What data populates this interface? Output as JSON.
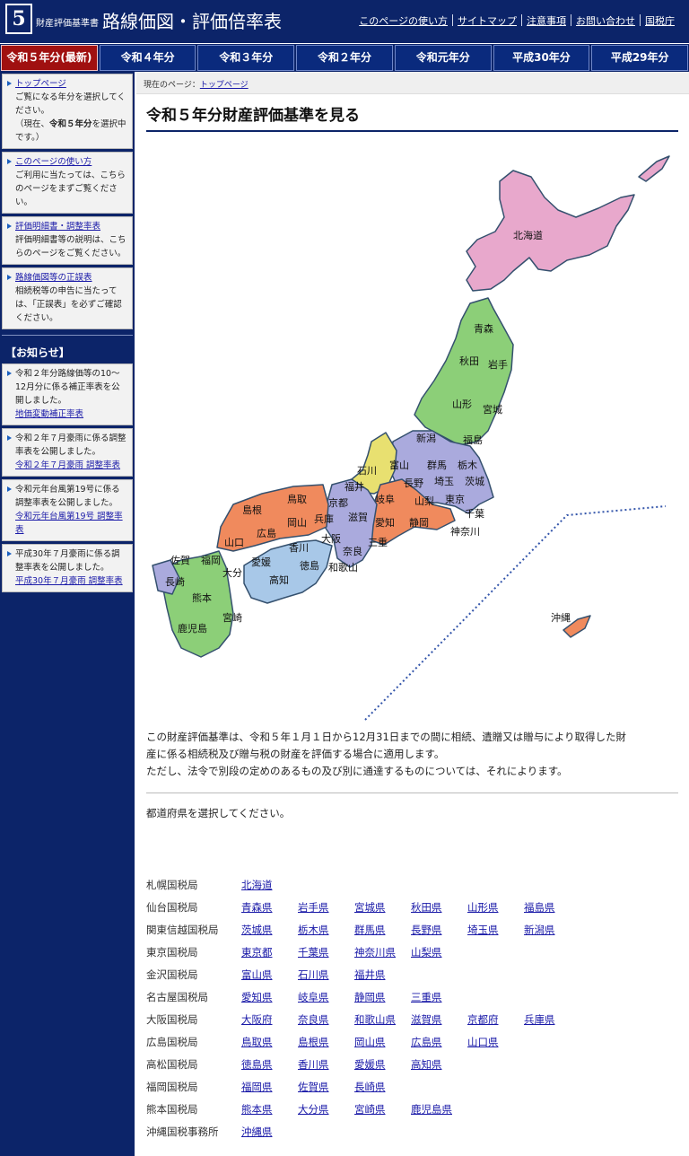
{
  "header": {
    "logo_number": "5",
    "small_title": "財産評価基準書",
    "title": "路線価図・評価倍率表",
    "nav": [
      "このページの使い方",
      "サイトマップ",
      "注意事項",
      "お問い合わせ",
      "国税庁"
    ]
  },
  "tabs": [
    "令和５年分(最新)",
    "令和４年分",
    "令和３年分",
    "令和２年分",
    "令和元年分",
    "平成30年分",
    "平成29年分"
  ],
  "sidebar": {
    "boxes": [
      {
        "title": "トップページ",
        "lines": [
          "ご覧になる年分を選択してください。",
          "（現在、",
          "令和５年分",
          "を選択中です。）"
        ]
      },
      {
        "title": "このページの使い方",
        "text": "ご利用に当たっては、こちらのページをまずご覧ください。"
      },
      {
        "title": "評価明細書・調整率表",
        "text": "評価明細書等の説明は、こちらのページをご覧ください。"
      },
      {
        "title": "路線価図等の正誤表",
        "text": "相続税等の申告に当たっては、「正誤表」を必ずご確認ください。"
      }
    ],
    "notice_heading": "【お知らせ】",
    "notices": [
      {
        "text": "令和２年分路線価等の10～12月分に係る補正率表を公開しました。",
        "link": "地価変動補正率表"
      },
      {
        "text": "令和２年７月豪雨に係る調整率表を公開しました。",
        "link": "令和２年７月豪雨 調整率表"
      },
      {
        "text": "令和元年台風第19号に係る調整率表を公開しました。",
        "link": "令和元年台風第19号 調整率表"
      },
      {
        "text": "平成30年７月豪雨に係る調整率表を公開しました。",
        "link": "平成30年７月豪雨 調整率表"
      }
    ]
  },
  "breadcrumb": {
    "prefix": "現在のページ：",
    "current": "トップページ"
  },
  "page_title": "令和５年分財産評価基準を見る",
  "map": {
    "colors": {
      "hokkaido": "#e8a8cc",
      "tohoku": "#8ccf78",
      "kanto": "#aaaadd",
      "hokuriku": "#e8e070",
      "tokai": "#f08a5d",
      "kinki": "#aaaadd",
      "chugoku": "#f08a5d",
      "shikoku": "#a8c8e8",
      "kyushu": "#8ccf78",
      "border": "#34506e",
      "okinawa_line": "#3355aa"
    },
    "labels": {
      "hokkaido": "北海道",
      "aomori": "青森",
      "akita": "秋田",
      "iwate": "岩手",
      "yamagata": "山形",
      "miyagi": "宮城",
      "niigata": "新潟",
      "fukushima": "福島",
      "ishikawa": "石川",
      "toyama": "富山",
      "gunma": "群馬",
      "tochigi": "栃木",
      "fukui": "福井",
      "nagano": "長野",
      "saitama": "埼玉",
      "ibaraki": "茨城",
      "kyoto": "京都",
      "gifu": "岐阜",
      "yamanashi": "山梨",
      "tokyo": "東京",
      "chiba": "千葉",
      "shimane": "島根",
      "tottori": "鳥取",
      "hyogo": "兵庫",
      "shiga": "滋賀",
      "aichi": "愛知",
      "shizuoka": "静岡",
      "kanagawa": "神奈川",
      "okayama": "岡山",
      "osaka": "大阪",
      "mie": "三重",
      "yamaguchi": "山口",
      "hiroshima": "広島",
      "kagawa": "香川",
      "nara": "奈良",
      "ehime": "愛媛",
      "tokushima": "徳島",
      "wakayama": "和歌山",
      "saga": "佐賀",
      "fukuoka": "福岡",
      "oita": "大分",
      "kochi": "高知",
      "nagasaki": "長崎",
      "kumamoto": "熊本",
      "miyazaki": "宮崎",
      "kagoshima": "鹿児島",
      "okinawa": "沖縄"
    }
  },
  "intro": {
    "line1": "この財産評価基準は、令和５年１月１日から12月31日までの間に相続、遺贈又は贈与により取得した財",
    "line2": "産に係る相続税及び贈与税の財産を評価する場合に適用します。",
    "line3": "ただし、法令で別段の定めのあるもの及び別に通達するものについては、それによります。"
  },
  "select_prompt": "都道府県を選択してください。",
  "bureaus": [
    {
      "name": "札幌国税局",
      "prefs": [
        "北海道"
      ]
    },
    {
      "name": "仙台国税局",
      "prefs": [
        "青森県",
        "岩手県",
        "宮城県",
        "秋田県",
        "山形県",
        "福島県"
      ]
    },
    {
      "name": "関東信越国税局",
      "prefs": [
        "茨城県",
        "栃木県",
        "群馬県",
        "長野県",
        "埼玉県",
        "新潟県"
      ]
    },
    {
      "name": "東京国税局",
      "prefs": [
        "東京都",
        "千葉県",
        "神奈川県",
        "山梨県"
      ]
    },
    {
      "name": "金沢国税局",
      "prefs": [
        "富山県",
        "石川県",
        "福井県"
      ]
    },
    {
      "name": "名古屋国税局",
      "prefs": [
        "愛知県",
        "岐阜県",
        "静岡県",
        "三重県"
      ]
    },
    {
      "name": "大阪国税局",
      "prefs": [
        "大阪府",
        "奈良県",
        "和歌山県",
        "滋賀県",
        "京都府",
        "兵庫県"
      ]
    },
    {
      "name": "広島国税局",
      "prefs": [
        "鳥取県",
        "島根県",
        "岡山県",
        "広島県",
        "山口県"
      ]
    },
    {
      "name": "高松国税局",
      "prefs": [
        "徳島県",
        "香川県",
        "愛媛県",
        "高知県"
      ]
    },
    {
      "name": "福岡国税局",
      "prefs": [
        "福岡県",
        "佐賀県",
        "長崎県"
      ]
    },
    {
      "name": "熊本国税局",
      "prefs": [
        "熊本県",
        "大分県",
        "宮崎県",
        "鹿児島県"
      ]
    },
    {
      "name": "沖縄国税事務所",
      "prefs": [
        "沖縄県"
      ]
    }
  ]
}
